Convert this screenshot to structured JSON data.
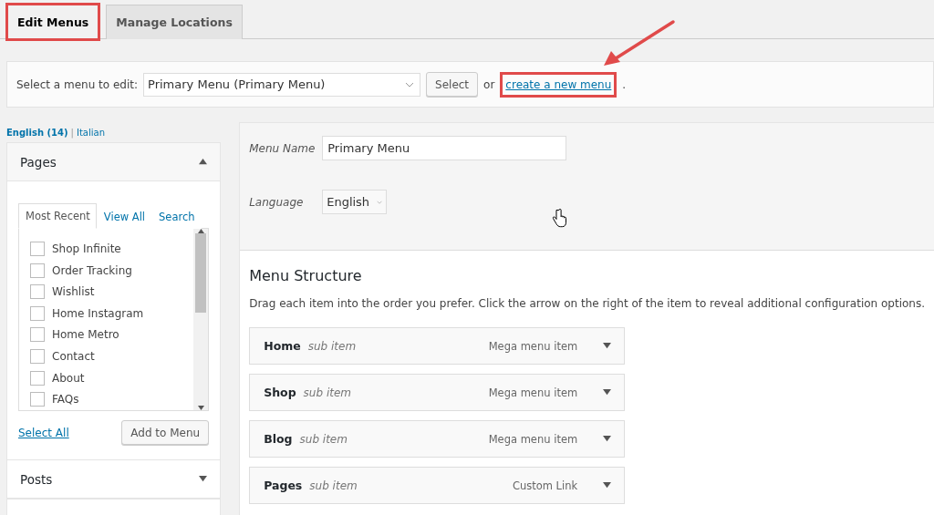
{
  "tabs": [
    {
      "label": "Edit Menus",
      "selected": true,
      "highlighted": true
    },
    {
      "label": "Manage Locations",
      "selected": false,
      "highlighted": false
    }
  ],
  "manage_bar": {
    "label": "Select a menu to edit:",
    "menu_select": "Primary Menu (Primary Menu)",
    "select_button": "Select",
    "or_text": "or",
    "create_link": "create a new menu",
    "create_link_highlighted": true,
    "period": "."
  },
  "languages": [
    {
      "label": "English (14)",
      "selected": true
    },
    {
      "label": "Italian",
      "selected": false
    }
  ],
  "language_separator": "|",
  "pages_panel": {
    "title": "Pages",
    "expanded": true,
    "tabs": [
      {
        "label": "Most Recent",
        "selected": true
      },
      {
        "label": "View All",
        "selected": false
      },
      {
        "label": "Search",
        "selected": false
      }
    ],
    "items": [
      {
        "label": "Shop Infinite",
        "checked": false
      },
      {
        "label": "Order Tracking",
        "checked": false
      },
      {
        "label": "Wishlist",
        "checked": false
      },
      {
        "label": "Home Instagram",
        "checked": false
      },
      {
        "label": "Home Metro",
        "checked": false
      },
      {
        "label": "Contact",
        "checked": false
      },
      {
        "label": "About",
        "checked": false
      },
      {
        "label": "FAQs",
        "checked": false
      }
    ],
    "select_all": "Select All",
    "add_button": "Add to Menu"
  },
  "posts_panel": {
    "title": "Posts",
    "expanded": false
  },
  "menu_settings": {
    "name_label": "Menu Name",
    "name_value": "Primary Menu",
    "language_label": "Language",
    "language_value": "English"
  },
  "structure": {
    "title": "Menu Structure",
    "description": "Drag each item into the order you prefer. Click the arrow on the right of the item to reveal additional configuration options.",
    "items": [
      {
        "title": "Home",
        "subtitle": "sub item",
        "type": "Mega menu item"
      },
      {
        "title": "Shop",
        "subtitle": "sub item",
        "type": "Mega menu item"
      },
      {
        "title": "Blog",
        "subtitle": "sub item",
        "type": "Mega menu item"
      },
      {
        "title": "Pages",
        "subtitle": "sub item",
        "type": "Custom Link"
      }
    ]
  }
}
